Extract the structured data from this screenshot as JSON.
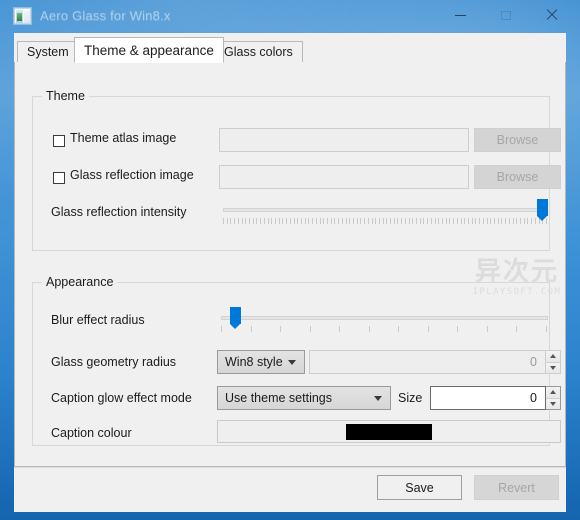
{
  "window": {
    "title": "Aero Glass for Win8.x",
    "icon": "app-window-icon",
    "controls": {
      "minimize": "minimize-icon",
      "maximize": "maximize-icon",
      "close": "close-icon"
    }
  },
  "tabs": [
    {
      "label": "System",
      "active": false
    },
    {
      "label": "Theme & appearance",
      "active": true
    },
    {
      "label": "Glass colors",
      "active": false
    }
  ],
  "theme_group": {
    "legend": "Theme",
    "atlas": {
      "label": "Theme atlas image",
      "checked": false,
      "value": "",
      "browse_label": "Browse"
    },
    "reflection": {
      "label": "Glass reflection image",
      "checked": false,
      "value": "",
      "browse_label": "Browse"
    },
    "intensity": {
      "label": "Glass reflection intensity",
      "value_pct": 100,
      "tick_count": 88
    }
  },
  "appearance_group": {
    "legend": "Appearance",
    "blur": {
      "label": "Blur effect radius",
      "value_pct": 3,
      "tick_count": 12
    },
    "geometry": {
      "label": "Glass geometry radius",
      "style_value": "Win8 style",
      "size_value": "0"
    },
    "caption_glow": {
      "label": "Caption glow effect mode",
      "mode_value": "Use theme settings",
      "size_label": "Size",
      "size_value": "0"
    },
    "caption_colour": {
      "label": "Caption colour",
      "swatch_color": "#000000"
    }
  },
  "footer": {
    "save_label": "Save",
    "revert_label": "Revert"
  },
  "watermark": {
    "cjk": "异次元",
    "latin": "IPLAYSOFT.COM"
  },
  "colors": {
    "accent": "#0078d7",
    "frame": "#2f86cf",
    "client": "#f0f0f0"
  }
}
